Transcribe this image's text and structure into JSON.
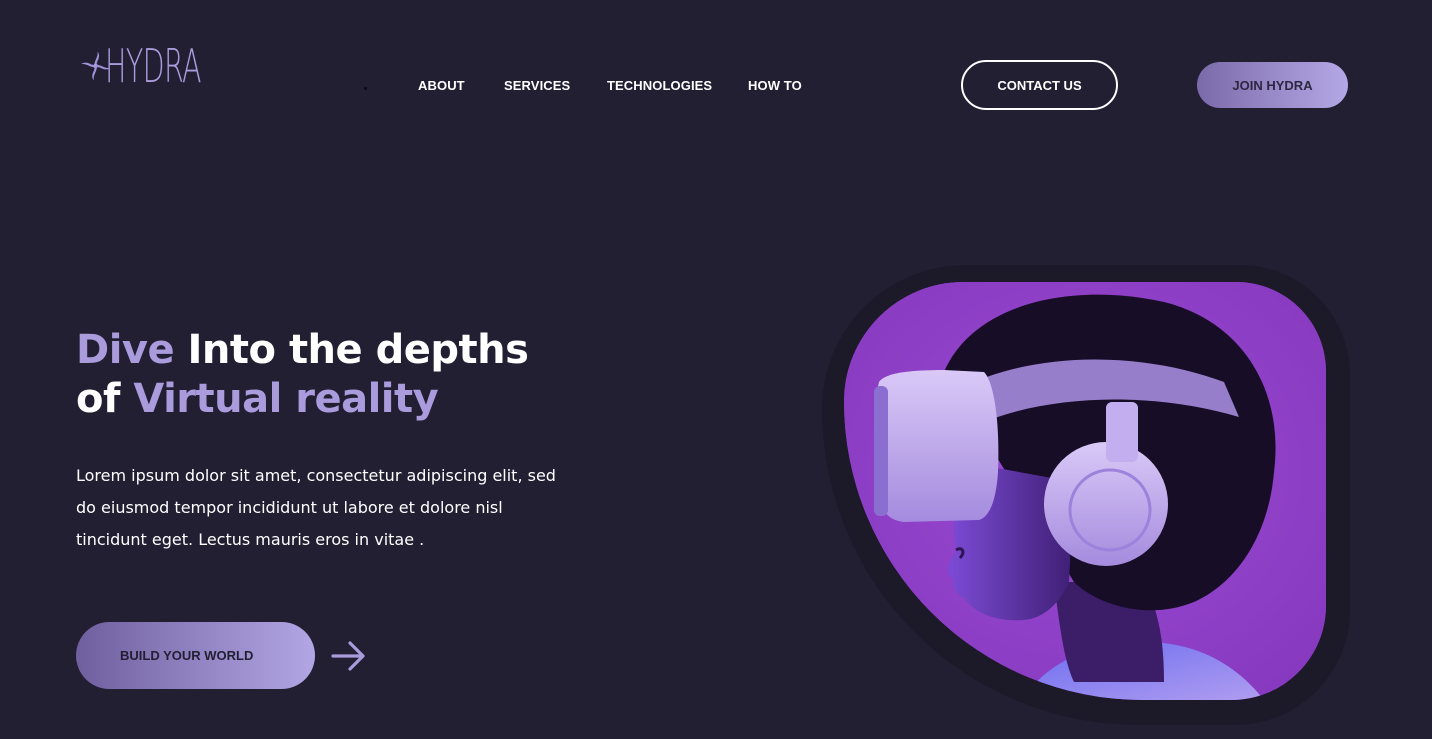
{
  "brand": {
    "name": "HYDRA",
    "logo_icon": "swirl-cross-icon",
    "accent_color": "#a99bdc"
  },
  "nav": {
    "items": [
      {
        "label": "ABOUT"
      },
      {
        "label": "SERVICES"
      },
      {
        "label": "TECHNOLOGIES"
      },
      {
        "label": "HOW TO"
      }
    ]
  },
  "header": {
    "contact_label": "CONTACT US",
    "join_label": "JOIN HYDRA"
  },
  "hero": {
    "title": {
      "line1_accent": "Dive",
      "line1_rest": " Into the depths",
      "line2_start": "of ",
      "line2_accent": "Virtual reality"
    },
    "description": "Lorem ipsum dolor sit amet, consectetur adipiscing elit, sed do eiusmod tempor incididunt ut labore et dolore nisl tincidunt eget. Lectus mauris eros in vitae .",
    "cta_label": "BUILD YOUR WORLD",
    "cta_icon": "arrow-right-icon",
    "image_icon": "vr-headset-person-image"
  },
  "colors": {
    "background": "#231f33",
    "accent": "#a99bdc",
    "button_gradient_start": "#7b6aa9",
    "button_gradient_end": "#b5a8e6",
    "image_background": "#8e3fc4"
  }
}
